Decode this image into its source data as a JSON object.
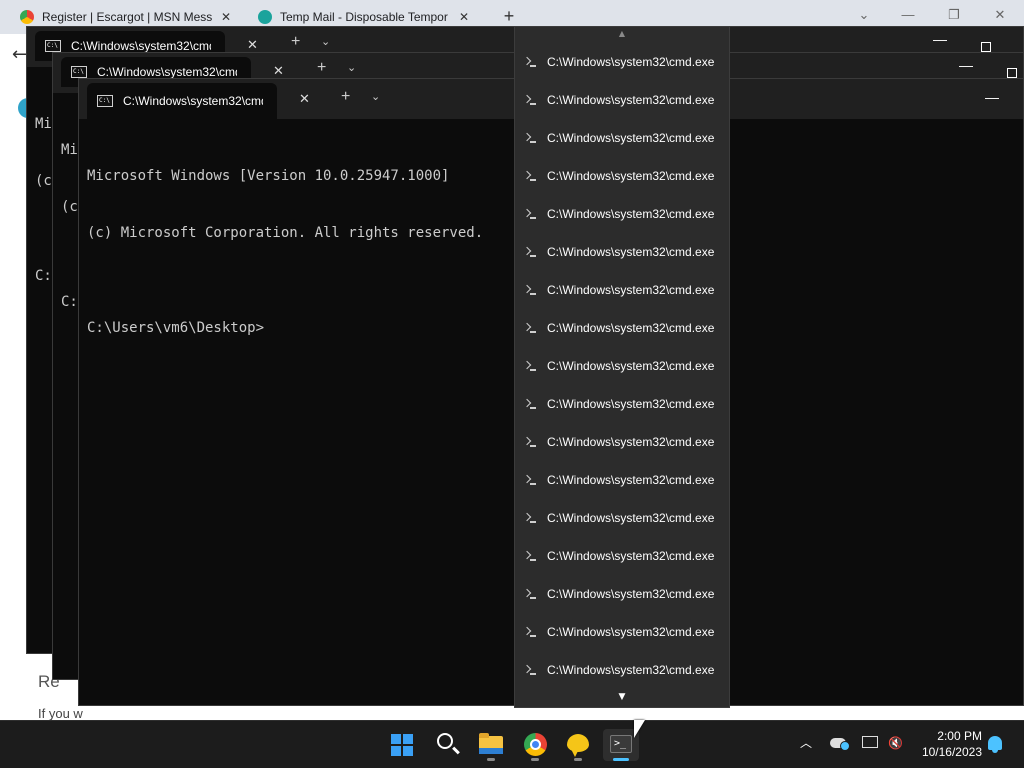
{
  "browser": {
    "tabs": [
      {
        "title": "Register | Escargot | MSN Messe",
        "favicon": "chrome-icon"
      },
      {
        "title": "Temp Mail - Disposable Tempor",
        "favicon": "tempmail-icon"
      }
    ],
    "new_tab": "+",
    "page_heading": "Re",
    "page_text": "If you w"
  },
  "terminals": [
    {
      "tab_title": "C:\\Windows\\system32\\cmd.e",
      "console_lines": [
        "Mi",
        "(c",
        "",
        "C:"
      ]
    },
    {
      "tab_title": "C:\\Windows\\system32\\cmd.e",
      "console_lines": [
        "Mi",
        "(c",
        "",
        "C:"
      ]
    },
    {
      "tab_title": "C:\\Windows\\system32\\cmd.e",
      "console_lines": [
        "Microsoft Windows [Version 10.0.25947.1000]",
        "(c) Microsoft Corporation. All rights reserved.",
        "",
        "C:\\Users\\vm6\\Desktop>"
      ]
    }
  ],
  "terminal_controls": {
    "close": "✕",
    "new_tab": "+",
    "dropdown": "⌄",
    "minimize": "—"
  },
  "tab_menu": {
    "scroll_up": "▲",
    "scroll_down": "▼",
    "item_icon": "terminal-icon",
    "items": [
      "C:\\Windows\\system32\\cmd.exe",
      "C:\\Windows\\system32\\cmd.exe",
      "C:\\Windows\\system32\\cmd.exe",
      "C:\\Windows\\system32\\cmd.exe",
      "C:\\Windows\\system32\\cmd.exe",
      "C:\\Windows\\system32\\cmd.exe",
      "C:\\Windows\\system32\\cmd.exe",
      "C:\\Windows\\system32\\cmd.exe",
      "C:\\Windows\\system32\\cmd.exe",
      "C:\\Windows\\system32\\cmd.exe",
      "C:\\Windows\\system32\\cmd.exe",
      "C:\\Windows\\system32\\cmd.exe",
      "C:\\Windows\\system32\\cmd.exe",
      "C:\\Windows\\system32\\cmd.exe",
      "C:\\Windows\\system32\\cmd.exe",
      "C:\\Windows\\system32\\cmd.exe",
      "C:\\Windows\\system32\\cmd.exe"
    ]
  },
  "taskbar": {
    "apps": [
      "start-icon",
      "search-icon",
      "file-explorer-icon",
      "chrome-icon",
      "messenger-icon",
      "terminal-icon"
    ],
    "tray_chevron": "^",
    "time": "2:00 PM",
    "date": "10/16/2023"
  },
  "colors": {
    "terminal_bg": "#0c0c0c",
    "menu_bg": "#2c2c2c",
    "taskbar_bg": "#1c1c1c",
    "accent": "#4cc2ff"
  }
}
